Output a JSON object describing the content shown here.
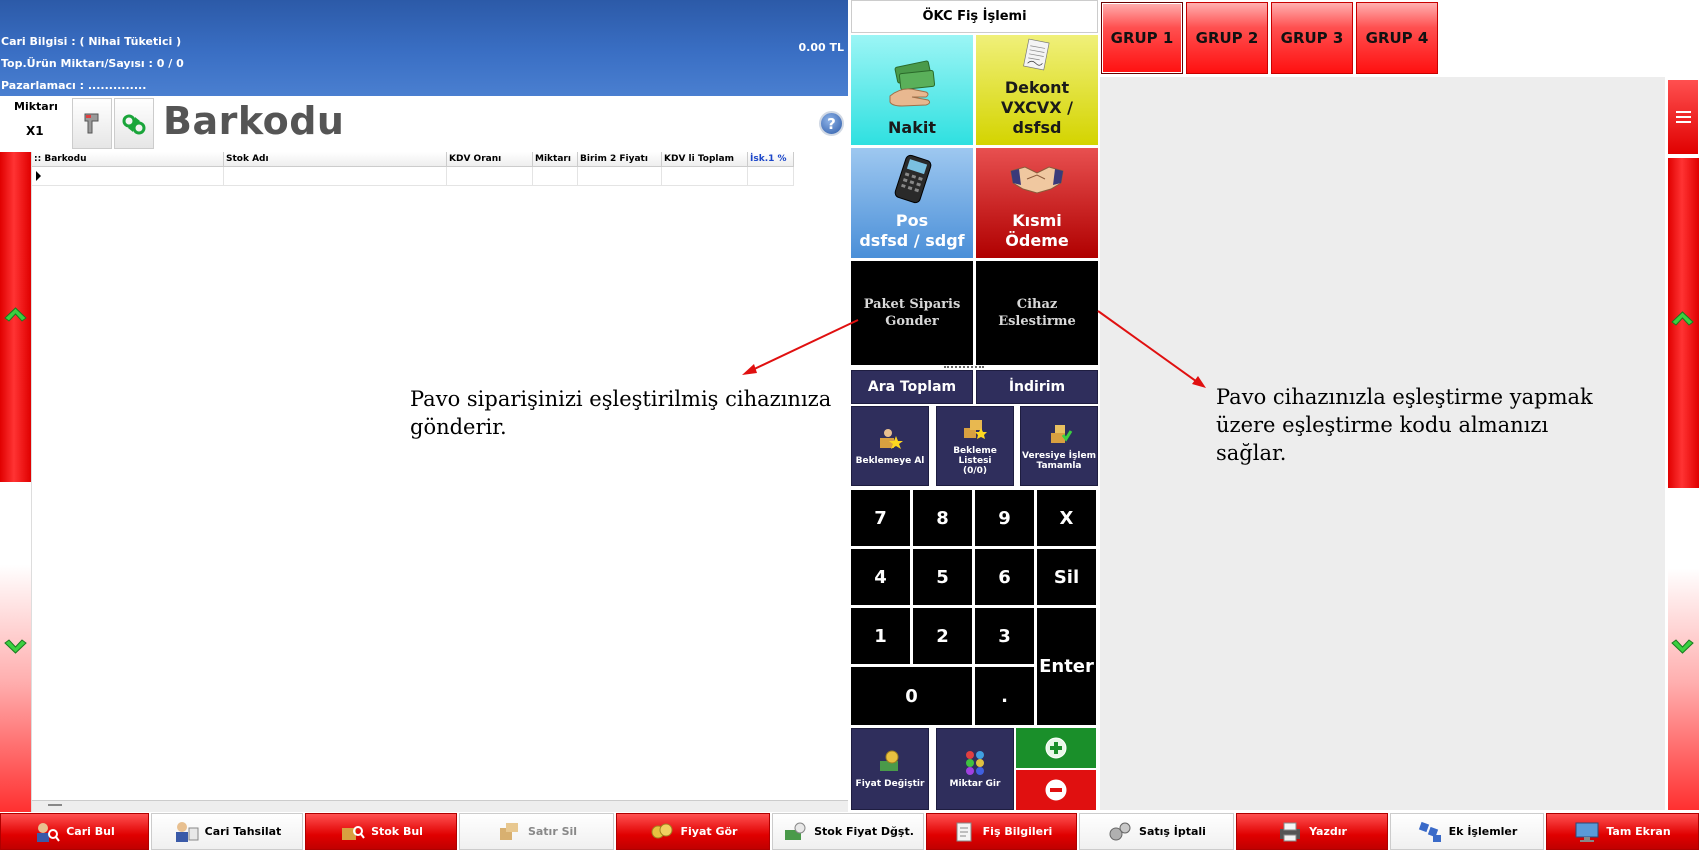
{
  "header": {
    "cari_bilgisi": "Cari Bilgisi : ( Nihai Tüketici )",
    "top_urun": "Top.Ürün Miktarı/Sayısı : 0  /  0",
    "pazarlamaci": "Pazarlamacı : ..............",
    "total": "0.00 TL"
  },
  "barcode_row": {
    "miktari_label": "Miktarı",
    "miktari_value": "X1",
    "barkodu_label": "Barkodu",
    "help": "?"
  },
  "grid": {
    "columns": [
      {
        "label": ":: Barkodu"
      },
      {
        "label": "Stok Adı"
      },
      {
        "label": "KDV Oranı"
      },
      {
        "label": "Miktarı"
      },
      {
        "label": "Birim 2 Fiyatı"
      },
      {
        "label": "KDV li Toplam"
      },
      {
        "label": "İsk.1 %"
      }
    ]
  },
  "panel": {
    "title": "ÖKC Fiş İşlemi",
    "nakit": "Nakit",
    "dekont_line1": "Dekont",
    "dekont_line2": "VXCVX / dsfsd",
    "pos_line1": "Pos",
    "pos_line2": "dsfsd / sdgf",
    "kismi_line1": "Kısmi",
    "kismi_line2": "Ödeme",
    "paket_line1": "Paket Siparis",
    "paket_line2": "Gonder",
    "cihaz": "Cihaz Eslestirme",
    "ara_toplam": "Ara Toplam",
    "indirim": "İndirim",
    "beklemeye_al": "Beklemeye Al",
    "bekleme_listesi_line1": "Bekleme Listesi",
    "bekleme_listesi_line2": "(0/0)",
    "veresiye_line1": "Veresiye İşlem",
    "veresiye_line2": "Tamamla",
    "keys": {
      "k7": "7",
      "k8": "8",
      "k9": "9",
      "kx": "X",
      "k4": "4",
      "k5": "5",
      "k6": "6",
      "ksil": "Sil",
      "k1": "1",
      "k2": "2",
      "k3": "3",
      "kenter": "Enter",
      "k0": "0",
      "kdot": "."
    },
    "fiyat_degistir": "Fiyat Değiştir",
    "miktar_gir": "Miktar Gir"
  },
  "groups": [
    "GRUP 1",
    "GRUP 2",
    "GRUP 3",
    "GRUP 4"
  ],
  "annotations": {
    "left_line1": "Pavo siparişinizi eşleştirilmiş cihazınıza",
    "left_line2": "gönderir.",
    "right_line1": "Pavo cihazınızla eşleştirme yapmak",
    "right_line2": "üzere eşleştirme kodu almanızı",
    "right_line3": "sağlar."
  },
  "toolbar": {
    "cari_bul": "Cari Bul",
    "cari_tahsilat": "Cari Tahsilat",
    "stok_bul": "Stok Bul",
    "satir_sil": "Satır Sil",
    "fiyat_gor": "Fiyat Gör",
    "stok_fiyat": "Stok Fiyat Dğşt.",
    "fis_bilgileri": "Fiş Bilgileri",
    "satis_iptali": "Satış İptali",
    "yazdir": "Yazdır",
    "ek_islemler": "Ek İşlemler",
    "tam_ekran": "Tam Ekran"
  },
  "colors": {
    "header_blue": "#2c5aa8",
    "accent_red": "#e00000",
    "navy": "#2f2e5c",
    "nakit_cyan": "#2fe0e0",
    "dekont_yellow": "#d4d400",
    "pos_blue": "#4a8fd8"
  }
}
